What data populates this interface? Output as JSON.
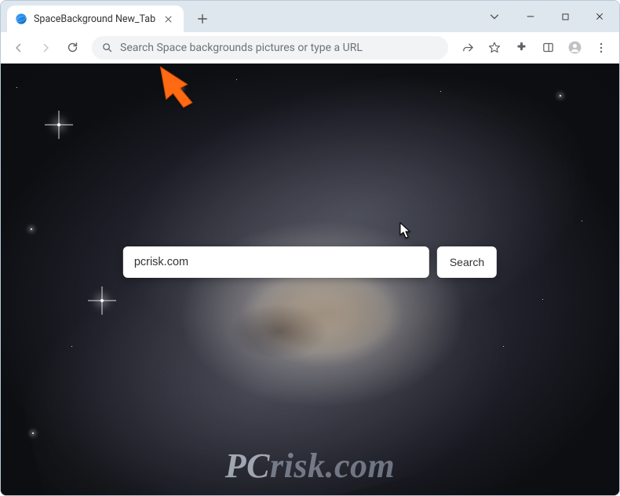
{
  "tab": {
    "title": "SpaceBackground New_Tab"
  },
  "omnibox": {
    "placeholder": "Search Space backgrounds pictures or type a URL"
  },
  "page": {
    "search_value": "pcrisk.com",
    "search_button_label": "Search"
  },
  "watermark": {
    "pc": "PC",
    "risk": "risk.com"
  }
}
